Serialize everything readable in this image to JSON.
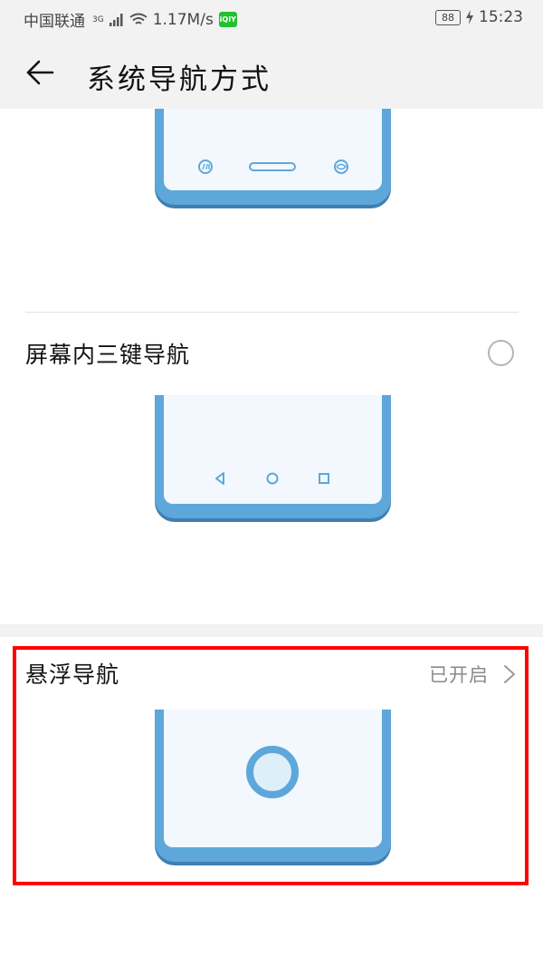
{
  "status_bar": {
    "carrier": "中国联通",
    "network_type": "3G",
    "speed": "1.17M/s",
    "app_badge": "iQIY",
    "battery": "88",
    "time": "15:23"
  },
  "header": {
    "title": "系统导航方式"
  },
  "options": [
    {
      "label": "",
      "nav_style": "gesture"
    },
    {
      "label": "屏幕内三键导航",
      "selected": false,
      "nav_style": "three-key"
    },
    {
      "label": "悬浮导航",
      "status": "已开启",
      "nav_style": "floating-dock"
    }
  ],
  "colors": {
    "phone_frame": "#5ea7da",
    "phone_screen": "#f2f8fd",
    "highlight": "#ff0000",
    "bar_background": "#f2f2f2"
  }
}
